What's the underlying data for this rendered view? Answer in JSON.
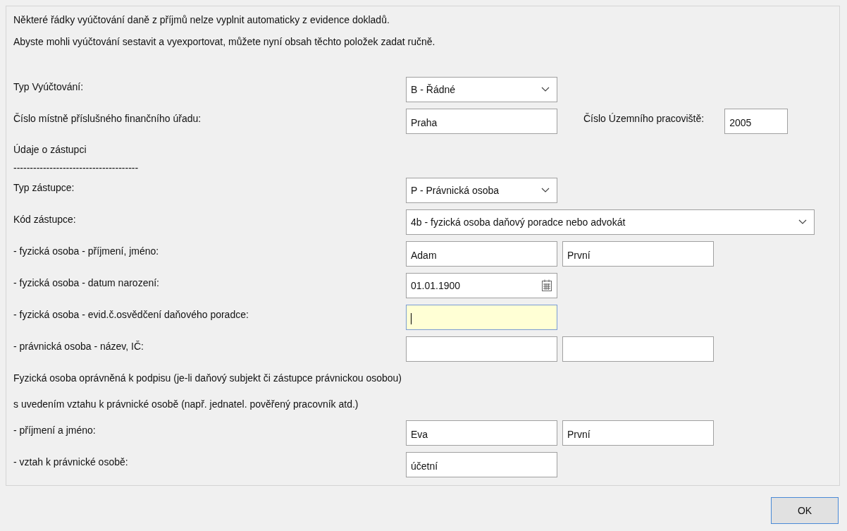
{
  "intro": [
    "Některé řádky vyúčtování daně z příjmů nelze vyplnit automaticky z evidence dokladů.",
    "Abyste mohli vyúčtování sestavit a vyexportovat, můžete nyní obsah těchto položek zadat ručně."
  ],
  "rows": [
    {
      "kind": "field",
      "label": "Typ Vyúčtování:",
      "controls": [
        {
          "kind": "select",
          "value": "B - Řádné"
        }
      ]
    },
    {
      "kind": "field",
      "label": "Číslo místně příslušného finančního úřadu:",
      "controls": [
        {
          "kind": "input",
          "value": "Praha"
        },
        {
          "kind": "label",
          "text": "Číslo Územního pracoviště:"
        },
        {
          "kind": "input_small",
          "value": "2005"
        }
      ]
    },
    {
      "kind": "heading",
      "text": "Údaje o zástupci"
    },
    {
      "kind": "separator",
      "text": "--------------------------------------"
    },
    {
      "kind": "field",
      "label": "Typ zástupce:",
      "controls": [
        {
          "kind": "select",
          "value": "P - Právnická osoba"
        }
      ]
    },
    {
      "kind": "field",
      "label": "Kód zástupce:",
      "controls": [
        {
          "kind": "select_wide",
          "value": "4b - fyzická osoba daňový poradce nebo advokát"
        }
      ]
    },
    {
      "kind": "field",
      "label": "- fyzická osoba - příjmení, jméno:",
      "controls": [
        {
          "kind": "input",
          "value": "Adam"
        },
        {
          "kind": "input",
          "value": "První"
        }
      ]
    },
    {
      "kind": "field",
      "label": "- fyzická osoba - datum narození:",
      "controls": [
        {
          "kind": "date",
          "value": "01.01.1900"
        }
      ]
    },
    {
      "kind": "field",
      "label": "- fyzická osoba - evid.č.osvědčení daňového poradce:",
      "controls": [
        {
          "kind": "input",
          "focused": true
        }
      ]
    },
    {
      "kind": "field",
      "label": "- právnická osoba - název, IČ:",
      "controls": [
        {
          "kind": "input",
          "focused": false
        },
        {
          "kind": "input",
          "focused": false
        }
      ]
    },
    {
      "kind": "note",
      "text": "Fyzická osoba oprávněná k podpisu (je-li daňový subjekt či zástupce právnickou osobou)"
    },
    {
      "kind": "note",
      "text": "s uvedením vztahu k právnické osobě (např. jednatel. pověřený pracovník atd.)"
    },
    {
      "kind": "field",
      "label": "- příjmení a jméno:",
      "controls": [
        {
          "kind": "input",
          "value": "Eva"
        },
        {
          "kind": "input",
          "value": "První"
        }
      ]
    },
    {
      "kind": "field",
      "label": "- vztah k právnické osobě:",
      "controls": [
        {
          "kind": "input",
          "value": "účetní"
        }
      ]
    }
  ],
  "buttons": [
    {
      "label": "OK"
    }
  ]
}
